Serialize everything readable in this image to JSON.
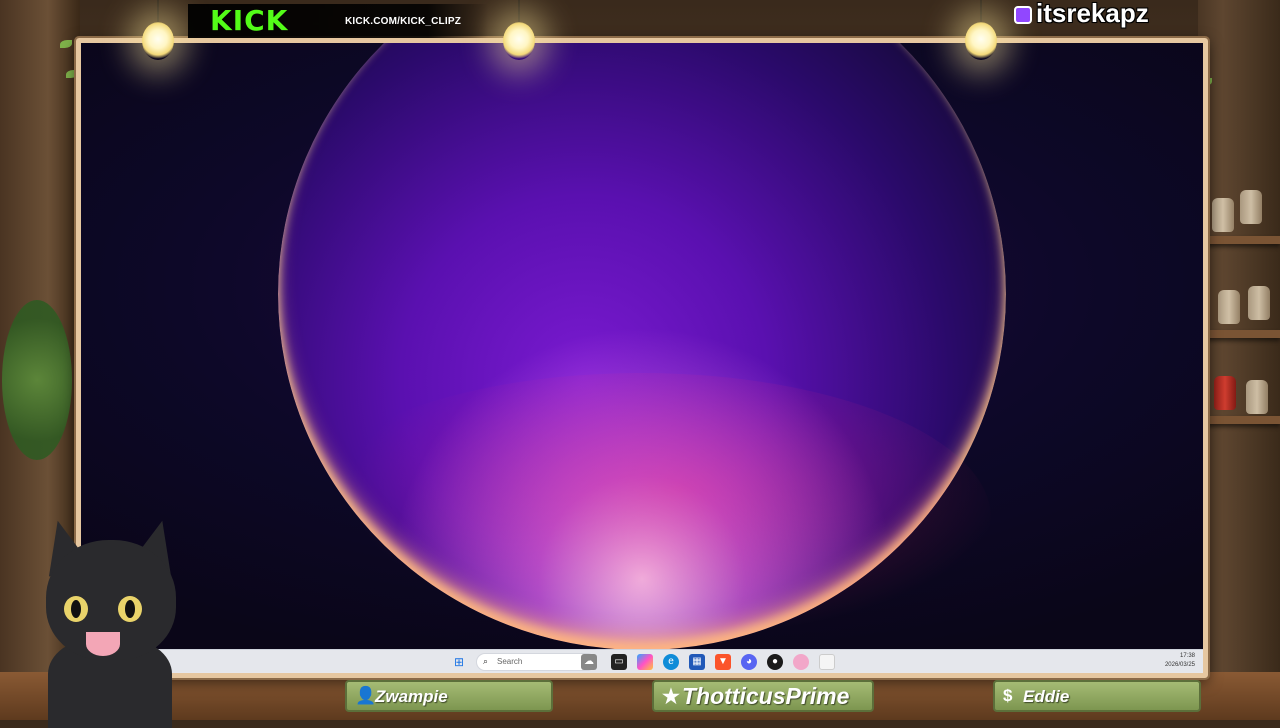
{
  "overlay": {
    "kick": {
      "logo": "KICK",
      "url": "KICK.COM/KICK_CLIPZ",
      "brand_color": "#53fc18"
    },
    "twitch": {
      "username": "itsrekapz",
      "icon": "twitch-icon",
      "brand_color": "#9147ff"
    },
    "namebars": [
      {
        "icon": "user-icon",
        "glyph": "👤",
        "label": "Zwampie"
      },
      {
        "icon": "star-icon",
        "glyph": "★",
        "label": "ThotticusPrime"
      },
      {
        "icon": "dollar-icon",
        "glyph": "$",
        "label": "Eddie"
      }
    ]
  },
  "taskbar": {
    "search_placeholder": "Search",
    "time": "17:38",
    "date": "2026/03/25",
    "apps": [
      "windows-start-icon",
      "search-icon",
      "widgets-icon",
      "task-view-icon",
      "copilot-icon",
      "edge-icon",
      "store-icon",
      "brave-icon",
      "discord-icon",
      "obs-icon",
      "app-icon",
      "file-icon"
    ]
  }
}
